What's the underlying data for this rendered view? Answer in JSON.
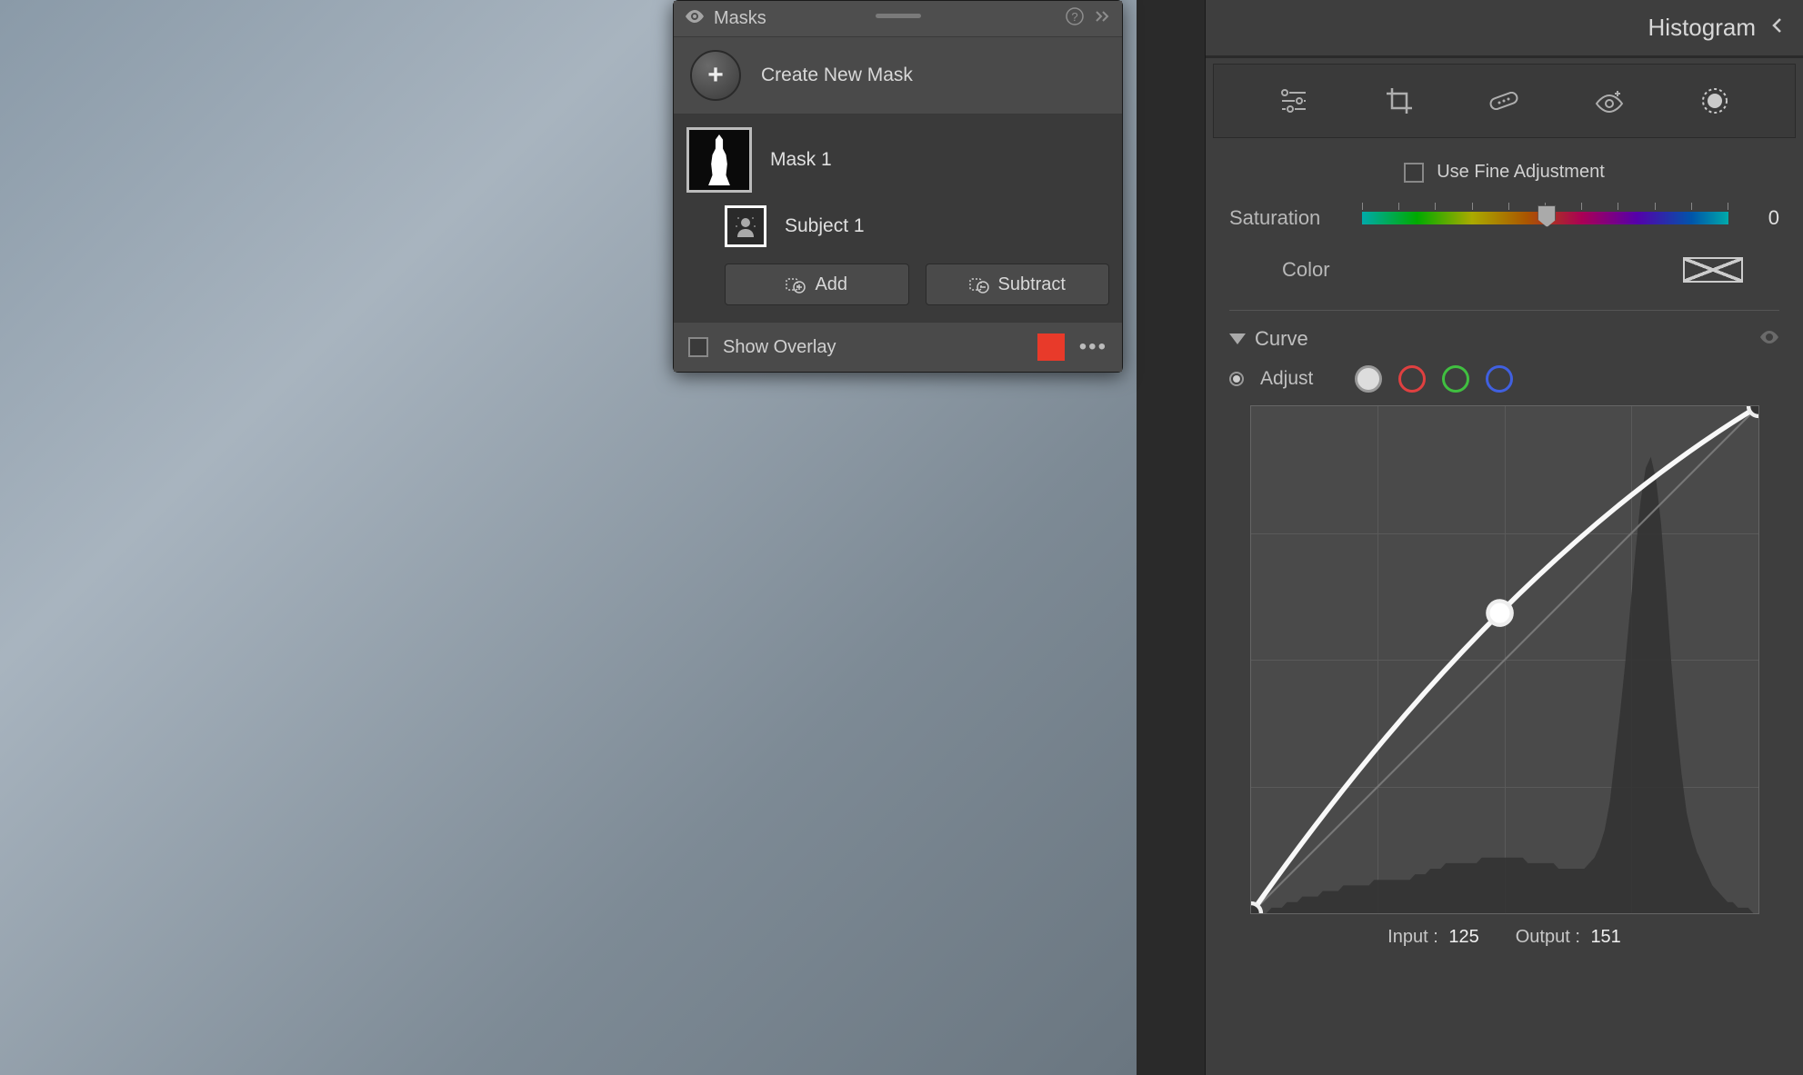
{
  "masks_panel": {
    "title": "Masks",
    "create_label": "Create New Mask",
    "mask_name": "Mask 1",
    "subject_name": "Subject 1",
    "add_label": "Add",
    "subtract_label": "Subtract",
    "show_overlay_label": "Show Overlay",
    "overlay_color": "#e83a2a"
  },
  "right_panel": {
    "histogram_title": "Histogram",
    "fine_label": "Use Fine Adjustment",
    "saturation_label": "Saturation",
    "saturation_value": "0",
    "color_label": "Color",
    "curve_title": "Curve",
    "adjust_label": "Adjust",
    "input_label": "Input :",
    "input_value": "125",
    "output_label": "Output :",
    "output_value": "151"
  },
  "chart_data": {
    "type": "line",
    "title": "Tone Curve",
    "xlabel": "Input",
    "ylabel": "Output",
    "xlim": [
      0,
      255
    ],
    "ylim": [
      0,
      255
    ],
    "control_points": [
      {
        "input": 0,
        "output": 0
      },
      {
        "input": 125,
        "output": 151
      },
      {
        "input": 255,
        "output": 255
      }
    ],
    "histogram_bins": [
      0,
      0,
      0,
      0,
      1,
      1,
      1,
      2,
      2,
      2,
      3,
      3,
      3,
      3,
      4,
      4,
      4,
      4,
      5,
      5,
      5,
      5,
      5,
      5,
      6,
      6,
      6,
      6,
      6,
      6,
      6,
      6,
      7,
      7,
      7,
      8,
      8,
      8,
      9,
      9,
      9,
      9,
      9,
      9,
      9,
      10,
      10,
      10,
      10,
      10,
      10,
      10,
      10,
      10,
      9,
      9,
      9,
      9,
      9,
      9,
      8,
      8,
      8,
      8,
      8,
      8,
      9,
      10,
      12,
      15,
      20,
      28,
      36,
      45,
      55,
      65,
      74,
      80,
      82,
      78,
      70,
      58,
      45,
      34,
      25,
      18,
      14,
      11,
      9,
      7,
      5,
      4,
      3,
      2,
      2,
      1,
      1,
      1,
      0,
      0
    ]
  }
}
